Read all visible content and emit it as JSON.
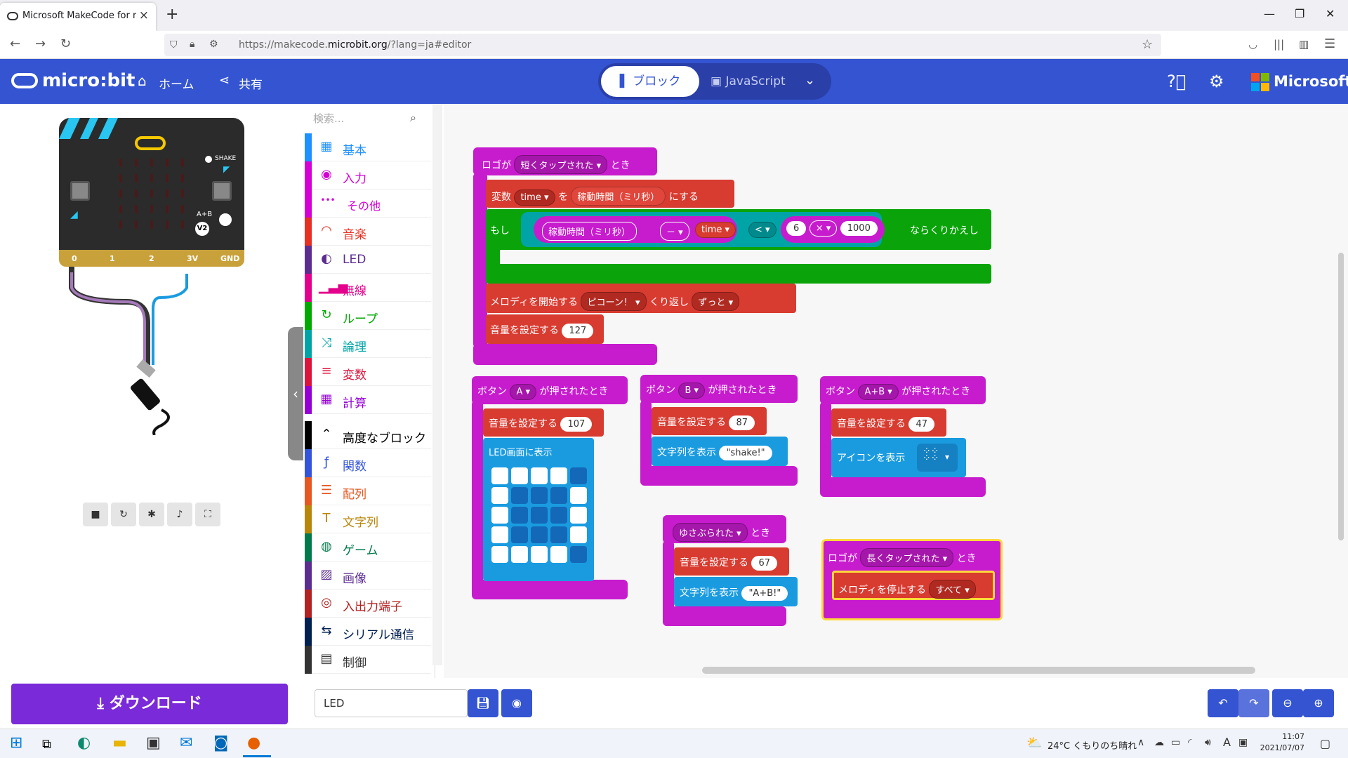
{
  "browser": {
    "tab_title": "Microsoft MakeCode for micro:bit",
    "tab_close": "×",
    "new_tab": "+",
    "url_prefix": "https://makecode.",
    "url_domain": "microbit.org",
    "url_suffix": "/?lang=ja#editor"
  },
  "header": {
    "logo": "micro:bit",
    "home": "ホーム",
    "share": "共有",
    "mode_blocks": "ブロック",
    "mode_js": "JavaScript",
    "brand": "Microsoft"
  },
  "simulator": {
    "shake_label": "SHAKE",
    "ab_label": "A+B",
    "v2_label": "V2",
    "pins": [
      "0",
      "1",
      "2",
      "3V",
      "GND"
    ]
  },
  "toolbox": {
    "search_placeholder": "検索...",
    "categories": [
      {
        "label": "基本",
        "color": "#1e90ff",
        "icon": "grid-icon"
      },
      {
        "label": "入力",
        "color": "#d400d4",
        "icon": "target-icon"
      },
      {
        "label": "その他",
        "color": "#d400d4",
        "icon": "more-icon"
      },
      {
        "label": "音楽",
        "color": "#e63022",
        "icon": "headphones-icon"
      },
      {
        "label": "LED",
        "color": "#5c2d91",
        "icon": "toggle-icon"
      },
      {
        "label": "無線",
        "color": "#e3008c",
        "icon": "signal-icon"
      },
      {
        "label": "ループ",
        "color": "#00aa00",
        "icon": "refresh-icon"
      },
      {
        "label": "論理",
        "color": "#00a4a6",
        "icon": "shuffle-icon"
      },
      {
        "label": "変数",
        "color": "#dc143c",
        "icon": "lines-icon"
      },
      {
        "label": "計算",
        "color": "#9400d3",
        "icon": "calculator-icon"
      },
      {
        "label": "高度なブロック",
        "color": "#000000",
        "icon": "chevron-up-icon"
      },
      {
        "label": "関数",
        "color": "#3455db",
        "icon": "function-icon"
      },
      {
        "label": "配列",
        "color": "#e65722",
        "icon": "list-icon"
      },
      {
        "label": "文字列",
        "color": "#b8860b",
        "icon": "text-icon"
      },
      {
        "label": "ゲーム",
        "color": "#007a4b",
        "icon": "gamepad-icon"
      },
      {
        "label": "画像",
        "color": "#5c2d91",
        "icon": "image-icon"
      },
      {
        "label": "入出力端子",
        "color": "#b22222",
        "icon": "pin-icon"
      },
      {
        "label": "シリアル通信",
        "color": "#002050",
        "icon": "usb-icon"
      },
      {
        "label": "制御",
        "color": "#333333",
        "icon": "control-icon"
      }
    ]
  },
  "blocks": {
    "b1_hat": "ロゴが",
    "b1_event": "短くタップされた",
    "b1_when": "とき",
    "b1_var": "変数",
    "b1_time": "time",
    "b1_wo": "を",
    "b1_runtime": "稼動時間（ミリ秒）",
    "b1_set": "にする",
    "b1_if": "もし",
    "b1_runtime2": "稼動時間（ミリ秒）",
    "b1_minus": "－",
    "b1_time2": "time",
    "b1_lt": "<",
    "b1_six": "6",
    "b1_mul": "×",
    "b1_1000": "1000",
    "b1_repeat": "ならくりかえし",
    "b1_melody": "メロディを開始する",
    "b1_beep": "ピコーン！",
    "b1_loop": "くり返し",
    "b1_forever": "ずっと",
    "b1_vol": "音量を設定する",
    "b1_vol_val": "127",
    "b2_hat": "ボタン",
    "b2_btn": "A",
    "b2_pressed": "が押されたとき",
    "b2_vol": "音量を設定する",
    "b2_vol_val": "107",
    "b2_led": "LED画面に表示",
    "b3_hat": "ボタン",
    "b3_btn": "B",
    "b3_pressed": "が押されたとき",
    "b3_vol": "音量を設定する",
    "b3_vol_val": "87",
    "b3_str": "文字列を表示",
    "b3_str_val": "\"shake!\"",
    "b4_hat": "ボタン",
    "b4_btn": "A+B",
    "b4_pressed": "が押されたとき",
    "b4_vol": "音量を設定する",
    "b4_vol_val": "47",
    "b4_icon": "アイコンを表示",
    "b5_event": "ゆさぶられた",
    "b5_when": "とき",
    "b5_vol": "音量を設定する",
    "b5_vol_val": "67",
    "b5_str": "文字列を表示",
    "b5_str_val": "\"A+B!\"",
    "b6_hat": "ロゴが",
    "b6_event": "長くタップされた",
    "b6_when": "とき",
    "b6_stop": "メロディを停止する",
    "b6_all": "すべて"
  },
  "bottom": {
    "download": "ダウンロード",
    "project_name": "LED"
  },
  "taskbar": {
    "weather": "24°C くもりのち晴れ",
    "time": "11:07",
    "date": "2021/07/07",
    "ime": "A"
  }
}
